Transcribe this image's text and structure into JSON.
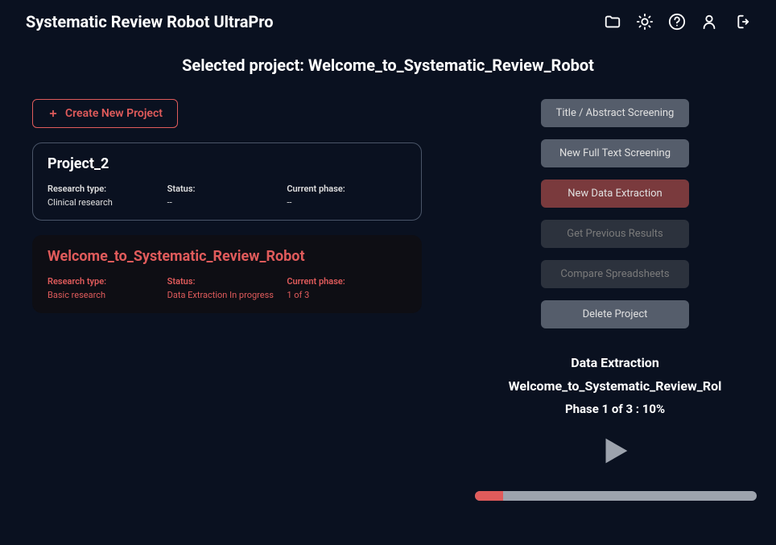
{
  "header": {
    "title": "Systematic Review Robot UltraPro"
  },
  "selected_project_prefix": "Selected project: ",
  "selected_project_name": "Welcome_to_Systematic_Review_Robot",
  "create_project_label": "Create New Project",
  "labels": {
    "research_type": "Research type:",
    "status": "Status:",
    "current_phase": "Current phase:"
  },
  "projects": [
    {
      "name": "Project_2",
      "research_type": "Clinical research",
      "status": "--",
      "current_phase": "--"
    },
    {
      "name": "Welcome_to_Systematic_Review_Robot",
      "research_type": "Basic research",
      "status": "Data Extraction In progress",
      "current_phase": "1 of 3"
    }
  ],
  "actions": {
    "title_abstract": "Title / Abstract Screening",
    "full_text": "New Full Text Screening",
    "data_extraction": "New Data Extraction",
    "previous_results": "Get Previous Results",
    "compare": "Compare Spreadsheets",
    "delete": "Delete Project"
  },
  "status_panel": {
    "title": "Data Extraction",
    "project_name": "Welcome_to_Systematic_Review_Rol",
    "phase_text": "Phase 1 of 3 : 10%",
    "progress_percent": 10
  }
}
